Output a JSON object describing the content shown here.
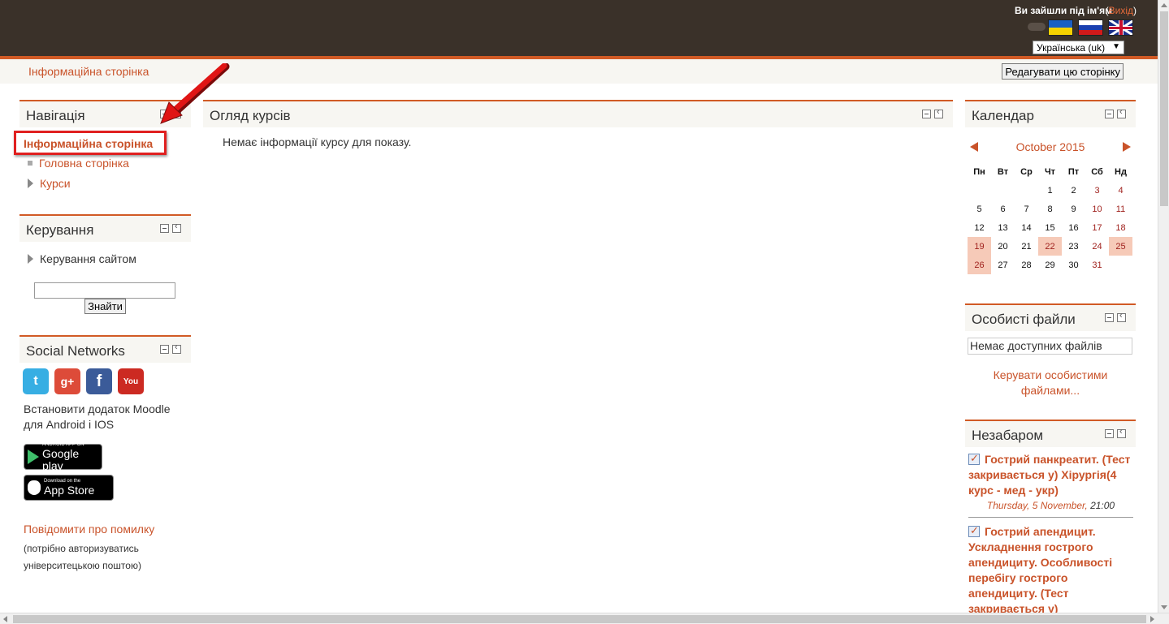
{
  "header": {
    "login_text": "Ви зайшли під ім'ям",
    "logout_label": "Вихід",
    "logout_open": "(",
    "logout_close": ")",
    "language_selected": "Українська (uk)",
    "flags": [
      "ukraine-flag",
      "russia-flag",
      "uk-flag"
    ]
  },
  "navbar": {
    "breadcrumb": "Інформаційна сторінка",
    "edit_button": "Редагувати цю сторінку"
  },
  "navigation": {
    "title": "Навігація",
    "active_item": "Інформаційна сторінка",
    "items": [
      "Головна сторінка",
      "Курси"
    ]
  },
  "admin": {
    "title": "Керування",
    "item": "Керування сайтом",
    "search_value": "",
    "search_button": "Знайти"
  },
  "social": {
    "title": "Social Networks",
    "icons": [
      "twitter-icon",
      "google-plus-icon",
      "facebook-icon",
      "youtube-icon"
    ],
    "gp_glyph": "g+",
    "fb_glyph": "f",
    "tw_glyph": "t",
    "yt_glyph": "You",
    "app_text": "Встановити додаток Moodle для Android і IOS",
    "google_play_small": "ANDROID APP ON",
    "google_play_big": "Google play",
    "app_store_small": "Download on the",
    "app_store_big": "App Store",
    "report_link": "Повідомити про помилку",
    "report_note": "(потрібно авторизуватись університецькою поштою)"
  },
  "courses": {
    "title": "Огляд курсів",
    "empty_text": "Немає інформації курсу для показу."
  },
  "calendar": {
    "title": "Календар",
    "month": "October 2015",
    "weekdays": [
      "Пн",
      "Вт",
      "Ср",
      "Чт",
      "Пт",
      "Сб",
      "Нд"
    ],
    "weeks": [
      [
        "",
        "",
        "",
        "1",
        "2",
        "3",
        "4"
      ],
      [
        "5",
        "6",
        "7",
        "8",
        "9",
        "10",
        "11"
      ],
      [
        "12",
        "13",
        "14",
        "15",
        "16",
        "17",
        "18"
      ],
      [
        "19",
        "20",
        "21",
        "22",
        "23",
        "24",
        "25"
      ],
      [
        "26",
        "27",
        "28",
        "29",
        "30",
        "31",
        ""
      ]
    ],
    "highlighted_days": [
      "19",
      "22",
      "25",
      "26"
    ]
  },
  "files": {
    "title": "Особисті файли",
    "empty_text": "Немає доступних файлів",
    "manage_link": "Керувати особистими файлами..."
  },
  "upcoming": {
    "title": "Незабаром",
    "events": [
      {
        "title": "Гострий панкреатит. (Тест закривається у) Хірургія(4 курс - мед - укр)",
        "date": "Thursday, 5 November,",
        "time": "21:00"
      },
      {
        "title": "Гострий апендицит. Ускладнення гострого апендициту. Особливості перебігу гострого апендициту. (Тест закривається у)",
        "date": "",
        "time": ""
      }
    ]
  },
  "colors": {
    "accent": "#d15a25",
    "link": "#c9532a",
    "header_bg": "#3a3129",
    "highlight": "#f6cab8"
  }
}
